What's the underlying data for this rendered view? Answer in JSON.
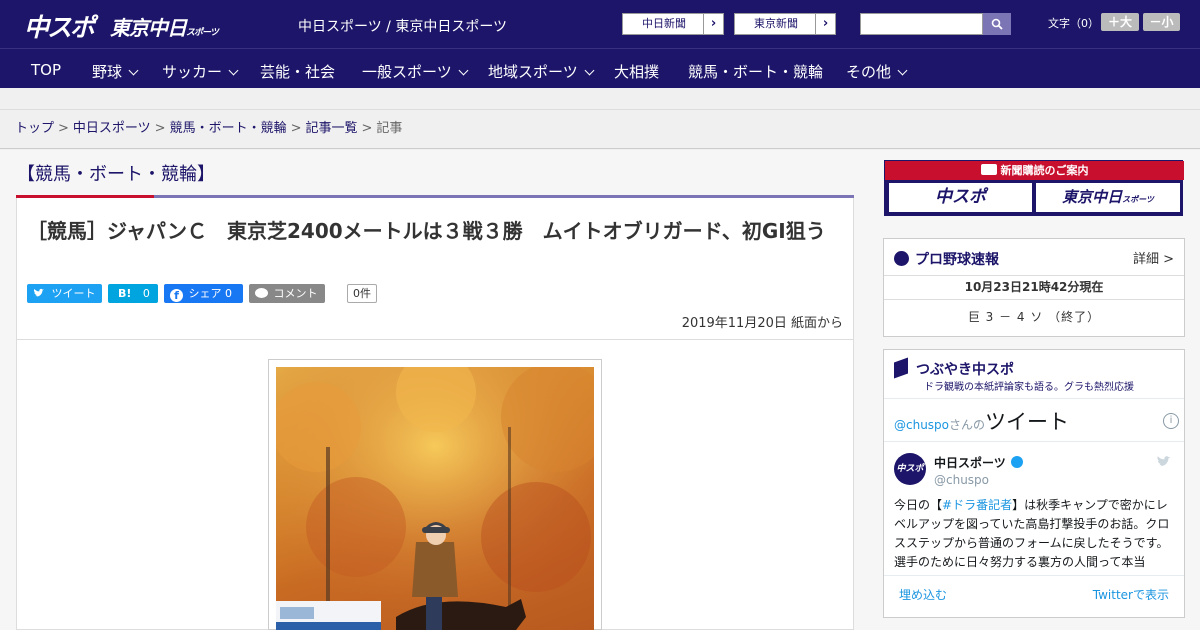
{
  "header": {
    "logo_main": "中スポ",
    "logo_tokyo": "東京中日",
    "logo_tokyo_sub": "スポーツ",
    "tagline": "中日スポーツ / 東京中日スポーツ",
    "paper_buttons": [
      "中日新聞",
      "東京新聞"
    ],
    "font_label": "文字（0）",
    "font_larger": "＋大",
    "font_smaller": "－小"
  },
  "nav": {
    "items": [
      {
        "label": "TOP",
        "dropdown": false
      },
      {
        "label": "野球",
        "dropdown": true
      },
      {
        "label": "サッカー",
        "dropdown": true
      },
      {
        "label": "芸能・社会",
        "dropdown": false
      },
      {
        "label": "一般スポーツ",
        "dropdown": true
      },
      {
        "label": "地域スポーツ",
        "dropdown": true
      },
      {
        "label": "大相撲",
        "dropdown": false
      },
      {
        "label": "競馬・ボート・競輪",
        "dropdown": false
      },
      {
        "label": "その他",
        "dropdown": true
      }
    ]
  },
  "breadcrumb": {
    "items": [
      "トップ",
      "中日スポーツ",
      "競馬・ボート・競輪",
      "記事一覧"
    ],
    "current": "記事",
    "separator": ">"
  },
  "category_title": "【競馬・ボート・競輪】",
  "article": {
    "title": "［競馬］ジャパンＣ　東京芝2400メートルは３戦３勝　ムイトオブリガード、初GI狙う",
    "tweet_label": "ツイート",
    "hatena_label": "B!",
    "hatena_count": "0",
    "share_label": "シェア",
    "share_count": "0",
    "comment_label": "コメント",
    "comment_count": "0件",
    "date": "2019年11月20日 紙面から"
  },
  "sidebar": {
    "banner_title": "新聞購読のご案内",
    "banner_left": "中スポ",
    "banner_right": "東京中日",
    "banner_right_sub": "スポーツ",
    "baseball": {
      "heading": "プロ野球速報",
      "detail_link": "詳細 >",
      "timestamp": "10月23日21時42分現在",
      "score": "巨 3 － 4 ソ （終了）"
    },
    "tsubuyaki": {
      "heading": "つぶやき中スポ",
      "subheading": "ドラ観戦の本紙評論家も語る。グラも熱烈応援",
      "handle": "@chuspo",
      "handle_suffix": "さんの",
      "tweets_label": "ツイート",
      "account_name": "中日スポーツ",
      "account_handle": "@chuspo",
      "avatar_text": "中スポ",
      "tweet_text_pre": "今日の【",
      "tweet_hashtag": "#ドラ番記者",
      "tweet_text_post": "】は秋季キャンプで密かにレベルアップを図っていた高島打撃投手のお話。クロスステップから普通のフォームに戻したそうです。選手のために日々努力する裏方の人間って本当",
      "embed_label": "埋め込む",
      "view_label": "Twitterで表示"
    }
  },
  "colors": {
    "brand": "#1c1569",
    "accent": "#c8102e",
    "twitter": "#1da1f2",
    "hatena": "#00a4de",
    "facebook": "#1877f2",
    "comment": "#888888"
  }
}
